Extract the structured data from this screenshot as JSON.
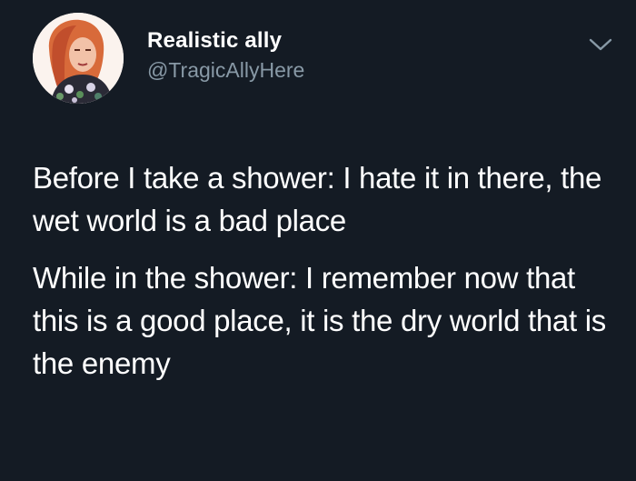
{
  "tweet": {
    "author": {
      "display_name": "Realistic ally",
      "handle": "@TragicAllyHere"
    },
    "menu_icon": "chevron-down-icon",
    "paragraphs": [
      "Before I take a shower: I hate it in there, the wet world is a bad place",
      "While in the shower: I remember now that this is a good place, it is the dry world that is the enemy"
    ]
  },
  "colors": {
    "background": "#141b24",
    "text": "#ffffff",
    "secondary_text": "#8899a6"
  }
}
